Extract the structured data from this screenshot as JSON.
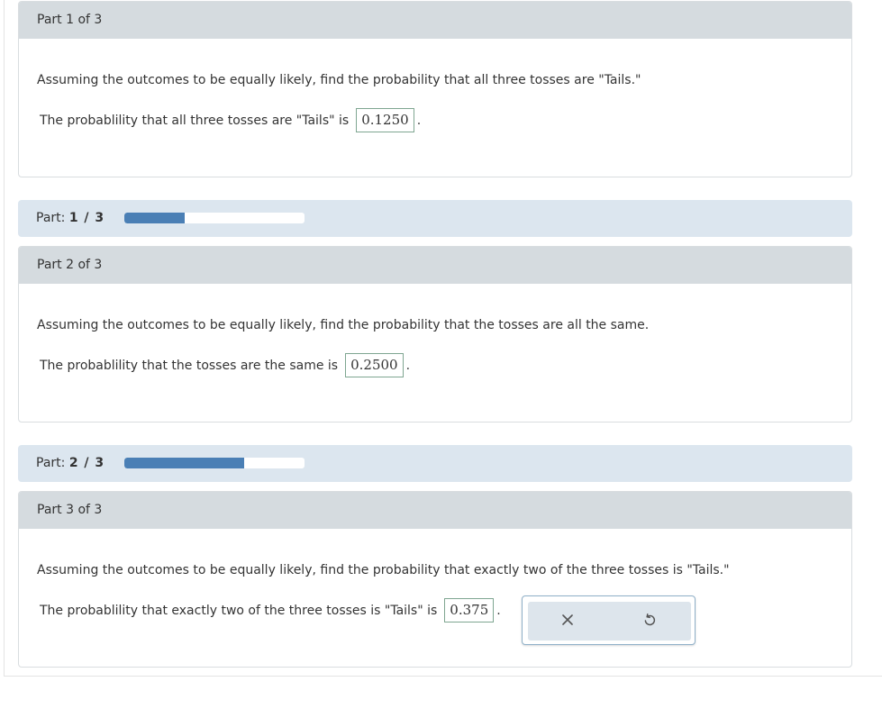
{
  "parts": [
    {
      "header": "Part 1 of 3",
      "question": "Assuming the outcomes to be equally likely, find the probability that all three tosses are \"Tails.\"",
      "answer_prefix": "The probablility that all three tosses are \"Tails\" is",
      "answer_value": "0.1250",
      "answer_suffix": "."
    },
    {
      "header": "Part 2 of 3",
      "question": "Assuming the outcomes to be equally likely, find the probability that the tosses are all the same.",
      "answer_prefix": "The probablility that the tosses are the same is",
      "answer_value": "0.2500",
      "answer_suffix": "."
    },
    {
      "header": "Part 3 of 3",
      "question": "Assuming the outcomes to be equally likely, find the probability that exactly two of the three tosses is \"Tails.\"",
      "answer_prefix": "The probablility that exactly two of the three tosses is \"Tails\" is",
      "answer_value": "0.375",
      "answer_suffix": "."
    }
  ],
  "progress": [
    {
      "label": "Part:",
      "count": "1 / 3",
      "fraction": 0.333
    },
    {
      "label": "Part:",
      "count": "2 / 3",
      "fraction": 0.667
    }
  ],
  "actions": {
    "clear_icon": "close-icon",
    "undo_icon": "undo-icon"
  },
  "colors": {
    "progress_fill": "#4a7fb5",
    "header_bg": "#d5dbdf",
    "progress_bg": "#dce6ef",
    "answer_border": "#7fa691"
  }
}
